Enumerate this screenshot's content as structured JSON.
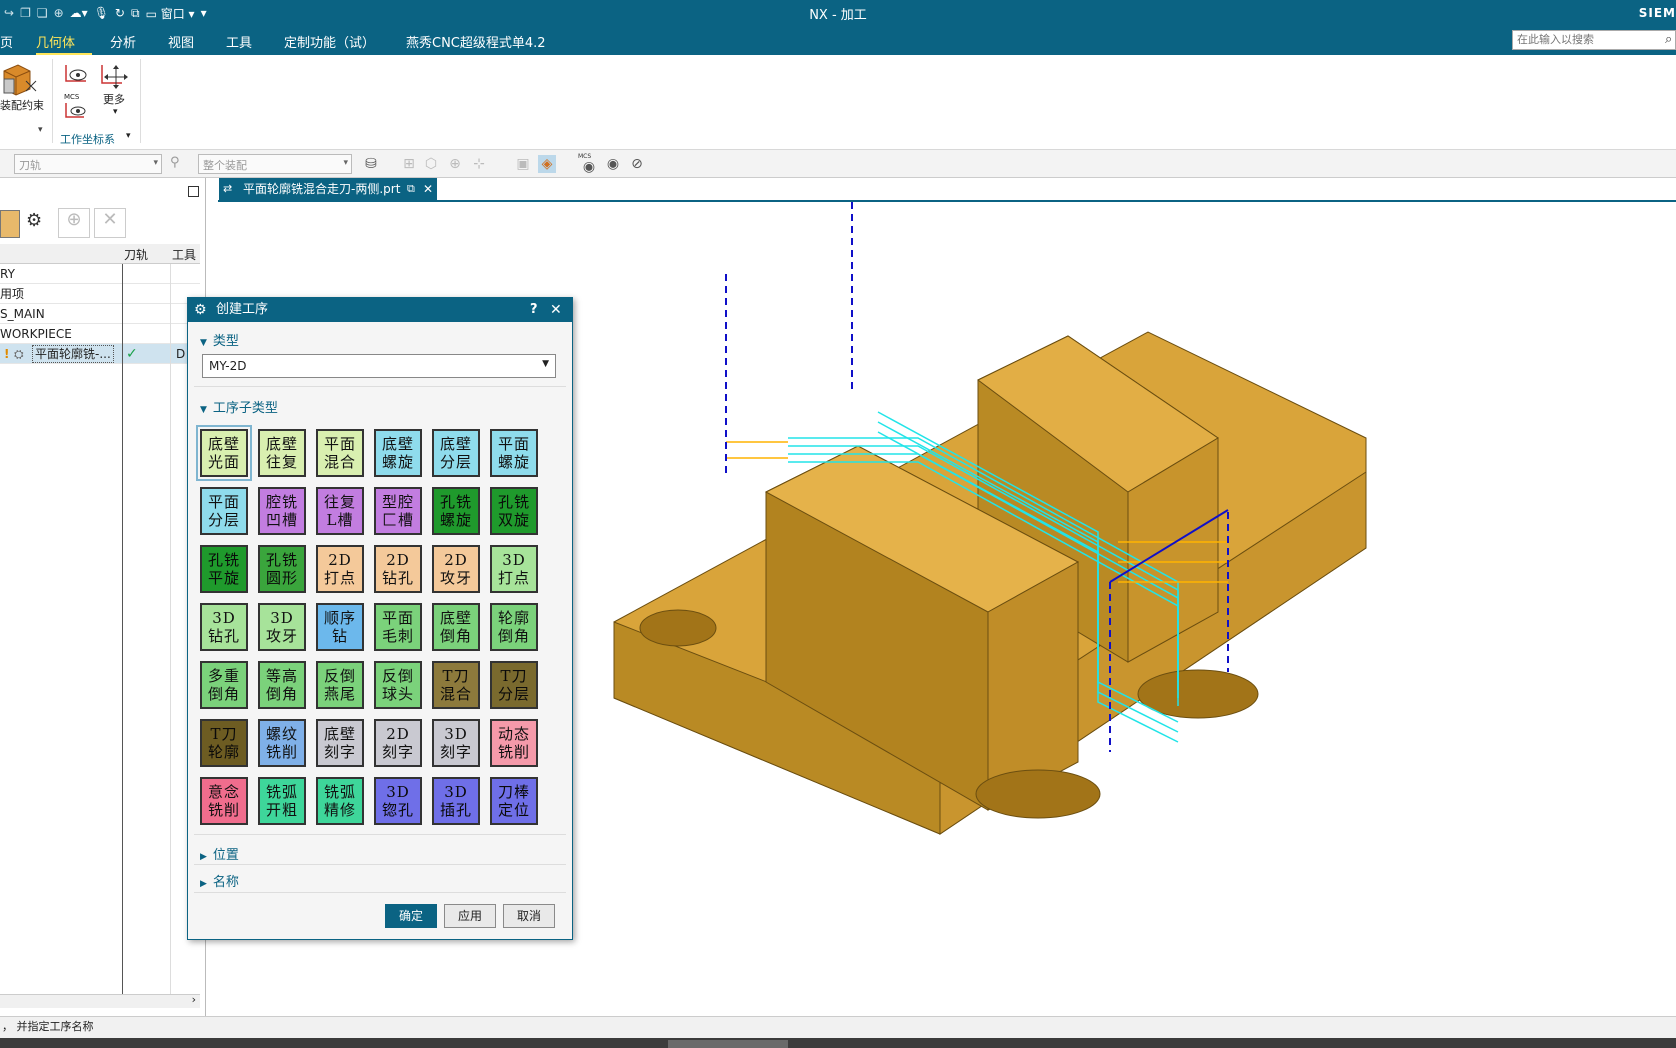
{
  "window": {
    "title": "NX - 加工",
    "brand": "SIEM"
  },
  "quick_access": {
    "window_menu": "窗口"
  },
  "menu": {
    "items": [
      "页",
      "几何体",
      "分析",
      "视图",
      "工具",
      "定制功能（试）",
      "燕秀CNC超级程式单4.2"
    ],
    "active_index": 1
  },
  "search": {
    "placeholder": "在此输入以搜索"
  },
  "ribbon": {
    "assembly_constraint": "装配约束",
    "more": "更多",
    "mcs_label": "MCS",
    "group_wcs": "工作坐标系"
  },
  "toolbar2": {
    "filter_combo": "刀轨",
    "assembly_combo": "整个装配",
    "mcs_icon_label": "MCS"
  },
  "navigator": {
    "col_toolpath": "刀轨",
    "col_tool": "工具",
    "rows": [
      "RY",
      "用项",
      "S_MAIN",
      "WORKPIECE",
      "平面轮廓铣-..."
    ],
    "row_tool_value": "D",
    "check": "✓"
  },
  "doc_tab": {
    "label": "平面轮廓铣混合走刀-两侧.prt"
  },
  "status": {
    "text": "， 并指定工序名称"
  },
  "dialog": {
    "title": "创建工序",
    "help": "?",
    "close": "✕",
    "section_type": "类型",
    "type_value": "MY-2D",
    "section_subtype": "工序子类型",
    "section_position": "位置",
    "section_name": "名称",
    "ok": "确定",
    "apply": "应用",
    "cancel": "取消",
    "ops": [
      {
        "t": "底壁光面",
        "c": "#d9efb0"
      },
      {
        "t": "底壁往复",
        "c": "#d9efb0"
      },
      {
        "t": "平面混合",
        "c": "#d9efb0"
      },
      {
        "t": "底壁螺旋",
        "c": "#8fdcec"
      },
      {
        "t": "底壁分层",
        "c": "#8fdcec"
      },
      {
        "t": "平面螺旋",
        "c": "#8fdcec"
      },
      {
        "t": "平面分层",
        "c": "#8fdcec"
      },
      {
        "t": "腔铣凹槽",
        "c": "#c27de0"
      },
      {
        "t": "往复L槽",
        "c": "#c27de0"
      },
      {
        "t": "型腔匚槽",
        "c": "#c27de0"
      },
      {
        "t": "孔铣螺旋",
        "c": "#1f9a2c"
      },
      {
        "t": "孔铣双旋",
        "c": "#1f9a2c"
      },
      {
        "t": "孔铣平旋",
        "c": "#1f9a2c"
      },
      {
        "t": "孔铣圆形",
        "c": "#3aa53c"
      },
      {
        "t": "2D打点",
        "c": "#f4c99a"
      },
      {
        "t": "2D钻孔",
        "c": "#f4c99a"
      },
      {
        "t": "2D攻牙",
        "c": "#f4c99a"
      },
      {
        "t": "3D打点",
        "c": "#a7e39a"
      },
      {
        "t": "3D钻孔",
        "c": "#a7e39a"
      },
      {
        "t": "3D攻牙",
        "c": "#a7e39a"
      },
      {
        "t": "顺序钻",
        "c": "#6cb8ec"
      },
      {
        "t": "平面毛刺",
        "c": "#7bd27b"
      },
      {
        "t": "底壁倒角",
        "c": "#7bd27b"
      },
      {
        "t": "轮廓倒角",
        "c": "#7bd27b"
      },
      {
        "t": "多重倒角",
        "c": "#7bd27b"
      },
      {
        "t": "等高倒角",
        "c": "#7bd27b"
      },
      {
        "t": "反倒燕尾",
        "c": "#7bd27b"
      },
      {
        "t": "反倒球头",
        "c": "#7bd27b"
      },
      {
        "t": "T刀混合",
        "c": "#8d7a3c"
      },
      {
        "t": "T刀分层",
        "c": "#7a6a2e"
      },
      {
        "t": "T刀轮廓",
        "c": "#6d5c22"
      },
      {
        "t": "螺纹铣削",
        "c": "#7fb0e8"
      },
      {
        "t": "底壁刻字",
        "c": "#c9c9d1"
      },
      {
        "t": "2D刻字",
        "c": "#c9c9d1"
      },
      {
        "t": "3D刻字",
        "c": "#c9c9d1"
      },
      {
        "t": "动态铣削",
        "c": "#f59aaa"
      },
      {
        "t": "意念铣削",
        "c": "#f06d8d"
      },
      {
        "t": "铣弧开粗",
        "c": "#3ed69a"
      },
      {
        "t": "铣弧精修",
        "c": "#3ed69a"
      },
      {
        "t": "3D锪孔",
        "c": "#6f6fe8"
      },
      {
        "t": "3D插孔",
        "c": "#6f6fe8"
      },
      {
        "t": "刀棒定位",
        "c": "#6f6fe8"
      }
    ]
  }
}
